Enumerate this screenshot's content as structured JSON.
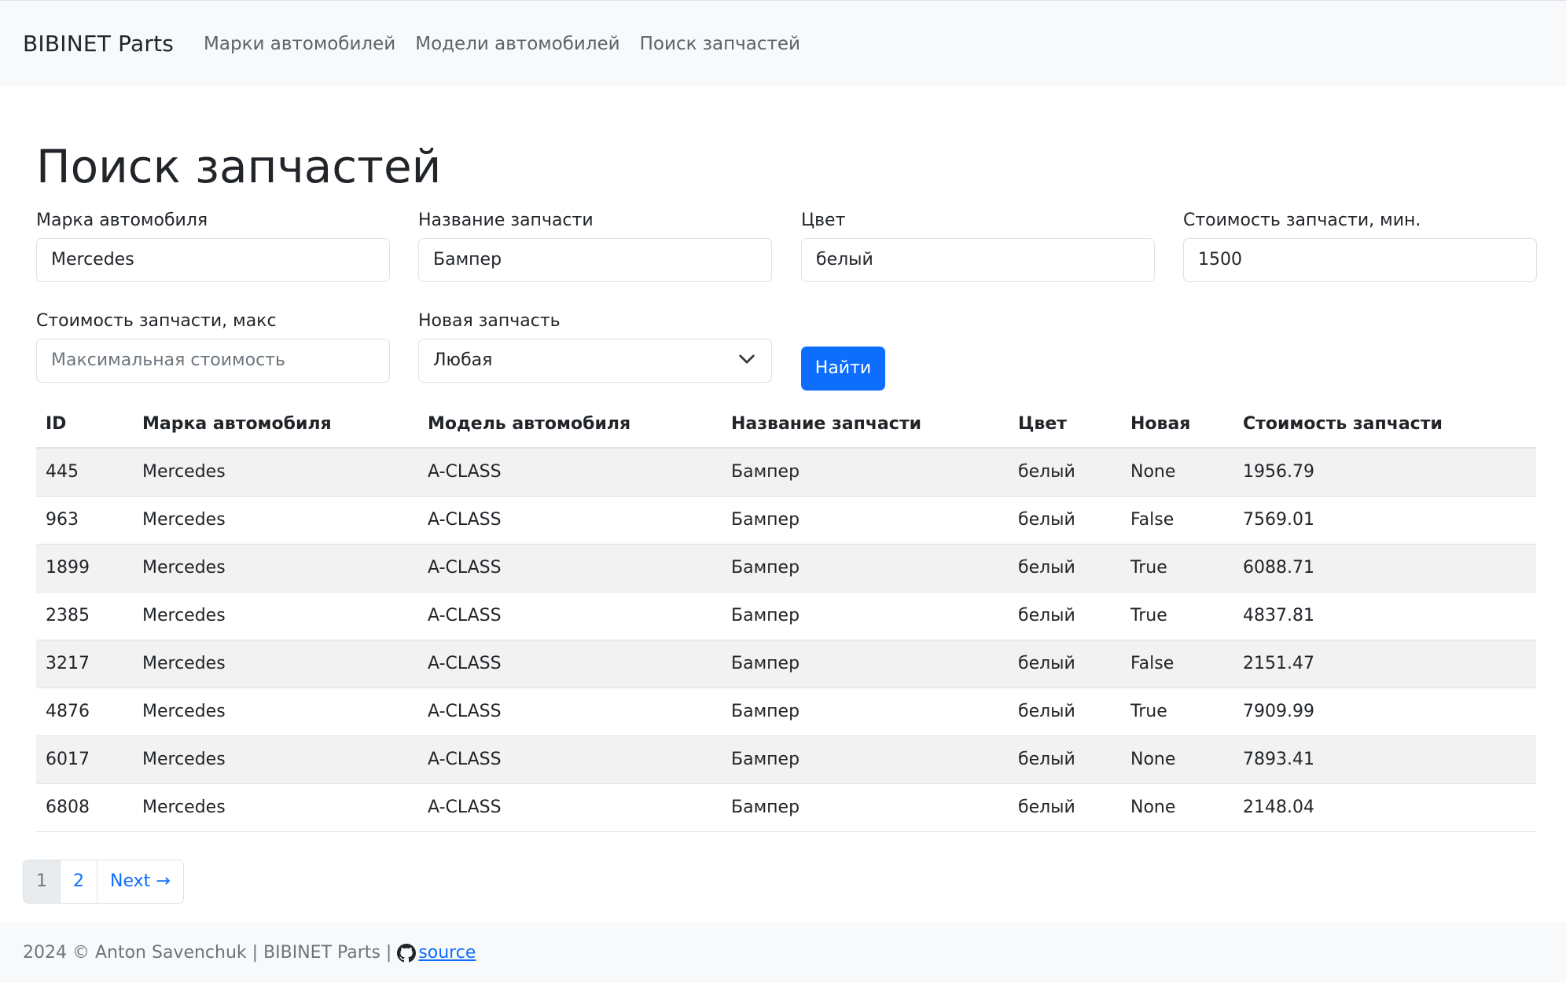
{
  "navbar": {
    "brand": "BIBINET Parts",
    "links": [
      "Марки автомобилей",
      "Модели автомобилей",
      "Поиск запчастей"
    ]
  },
  "page_title": "Поиск запчастей",
  "form": {
    "brand": {
      "label": "Марка автомобиля",
      "value": "Mercedes"
    },
    "part_name": {
      "label": "Название запчасти",
      "value": "Бампер"
    },
    "color": {
      "label": "Цвет",
      "value": "белый"
    },
    "price_min": {
      "label": "Стоимость запчасти, мин.",
      "value": "1500"
    },
    "price_max": {
      "label": "Стоимость запчасти, макс",
      "placeholder": "Максимальная стоимость"
    },
    "is_new": {
      "label": "Новая запчасть",
      "value": "Любая"
    },
    "submit_label": "Найти"
  },
  "table": {
    "headers": [
      "ID",
      "Марка автомобиля",
      "Модель автомобиля",
      "Название запчасти",
      "Цвет",
      "Новая",
      "Стоимость запчасти"
    ],
    "rows": [
      [
        "445",
        "Mercedes",
        "A-CLASS",
        "Бампер",
        "белый",
        "None",
        "1956.79"
      ],
      [
        "963",
        "Mercedes",
        "A-CLASS",
        "Бампер",
        "белый",
        "False",
        "7569.01"
      ],
      [
        "1899",
        "Mercedes",
        "A-CLASS",
        "Бампер",
        "белый",
        "True",
        "6088.71"
      ],
      [
        "2385",
        "Mercedes",
        "A-CLASS",
        "Бампер",
        "белый",
        "True",
        "4837.81"
      ],
      [
        "3217",
        "Mercedes",
        "A-CLASS",
        "Бампер",
        "белый",
        "False",
        "2151.47"
      ],
      [
        "4876",
        "Mercedes",
        "A-CLASS",
        "Бампер",
        "белый",
        "True",
        "7909.99"
      ],
      [
        "6017",
        "Mercedes",
        "A-CLASS",
        "Бампер",
        "белый",
        "None",
        "7893.41"
      ],
      [
        "6808",
        "Mercedes",
        "A-CLASS",
        "Бампер",
        "белый",
        "None",
        "2148.04"
      ]
    ]
  },
  "pagination": {
    "pages": [
      "1",
      "2"
    ],
    "active": "1",
    "next_label": "Next →"
  },
  "footer": {
    "text": "2024 © Anton Savenchuk | BIBINET Parts |",
    "source_label": "source",
    "icon": "github-icon"
  },
  "colors": {
    "primary": "#0d6efd",
    "navbar_bg": "#f8f9fa",
    "stripe": "#f2f2f2"
  }
}
